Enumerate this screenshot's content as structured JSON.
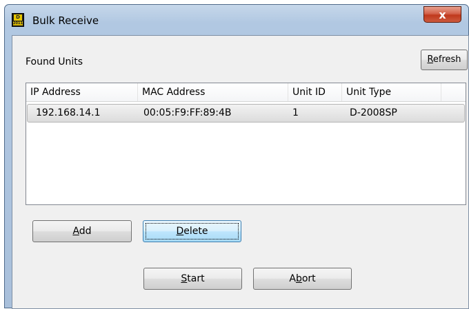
{
  "window": {
    "title": "Bulk Receive",
    "close_symbol": "x"
  },
  "app_icon": {
    "top_text": "D",
    "bottom_text": "2011"
  },
  "found_units_label": "Found Units",
  "buttons": {
    "refresh": {
      "before": "",
      "mnemonic": "R",
      "after": "efresh"
    },
    "add": {
      "before": "",
      "mnemonic": "A",
      "after": "dd"
    },
    "delete": {
      "before": "",
      "mnemonic": "D",
      "after": "elete"
    },
    "start": {
      "before": "",
      "mnemonic": "S",
      "after": "tart"
    },
    "abort": {
      "before": "A",
      "mnemonic": "b",
      "after": "ort"
    }
  },
  "table": {
    "columns": [
      "IP Address",
      "MAC Address",
      "Unit ID",
      "Unit Type"
    ],
    "rows": [
      {
        "ip": "192.168.14.1",
        "mac": "00:05:F9:FF:89:4B",
        "unit_id": "1",
        "unit_type": "D-2008SP",
        "selected": true
      }
    ]
  }
}
